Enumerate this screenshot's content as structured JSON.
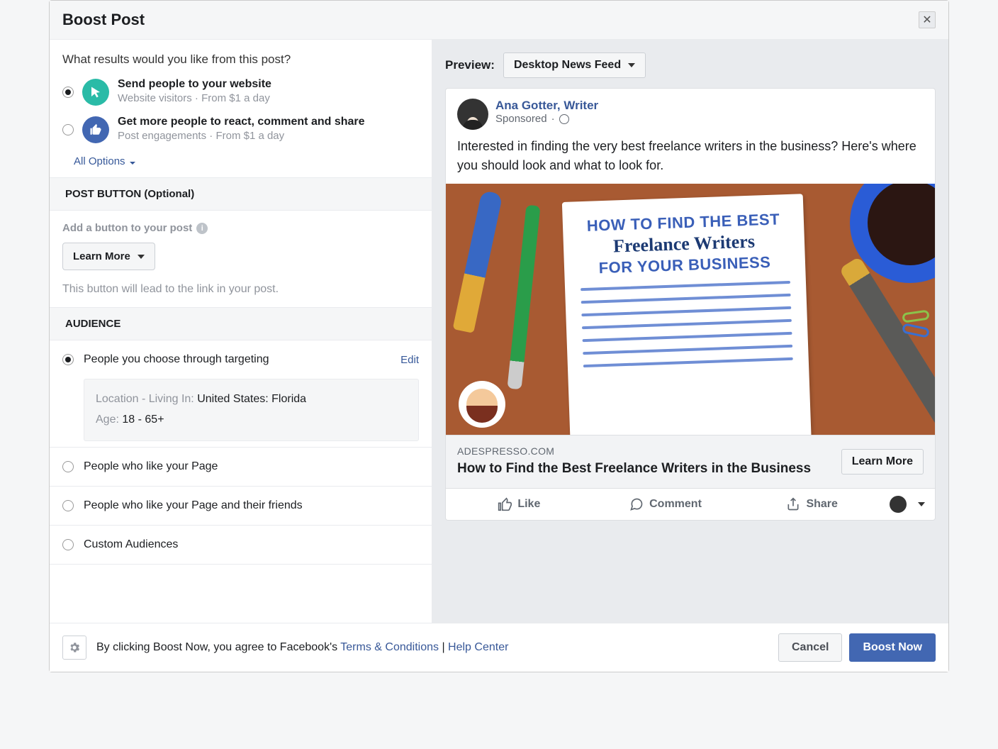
{
  "header": {
    "title": "Boost Post"
  },
  "question": "What results would you like from this post?",
  "objectives": [
    {
      "title": "Send people to your website",
      "sub_a": "Website visitors",
      "sub_b": "From $1 a day",
      "selected": true
    },
    {
      "title": "Get more people to react, comment and share",
      "sub_a": "Post engagements",
      "sub_b": "From $1 a day",
      "selected": false
    }
  ],
  "all_options": "All Options",
  "post_button": {
    "header": "POST BUTTON (Optional)",
    "label": "Add a button to your post",
    "selected": "Learn More",
    "help": "This button will lead to the link in your post."
  },
  "audience": {
    "header": "AUDIENCE",
    "options": [
      "People you choose through targeting",
      "People who like your Page",
      "People who like your Page and their friends",
      "Custom Audiences"
    ],
    "edit": "Edit",
    "details": {
      "location_key": "Location - Living In:",
      "location_val": "United States: Florida",
      "age_key": "Age:",
      "age_val": "18 - 65+"
    }
  },
  "preview": {
    "label": "Preview:",
    "selected": "Desktop News Feed",
    "author": "Ana Gotter, Writer",
    "meta": "Sponsored",
    "text": "Interested in finding the very best freelance writers in the business? Here's where you should look and what to look for.",
    "image_line1": "HOW TO FIND THE BEST",
    "image_line2": "Freelance Writers",
    "image_line3": "FOR YOUR BUSINESS",
    "link_domain": "ADESPRESSO.COM",
    "link_title": "How to Find the Best Freelance Writers in the Business",
    "cta": "Learn More",
    "actions": {
      "like": "Like",
      "comment": "Comment",
      "share": "Share"
    }
  },
  "footer": {
    "text_prefix": "By clicking Boost Now, you agree to Facebook's ",
    "terms": "Terms & Conditions",
    "sep": "  |  ",
    "help": "Help Center",
    "cancel": "Cancel",
    "boost": "Boost Now"
  }
}
